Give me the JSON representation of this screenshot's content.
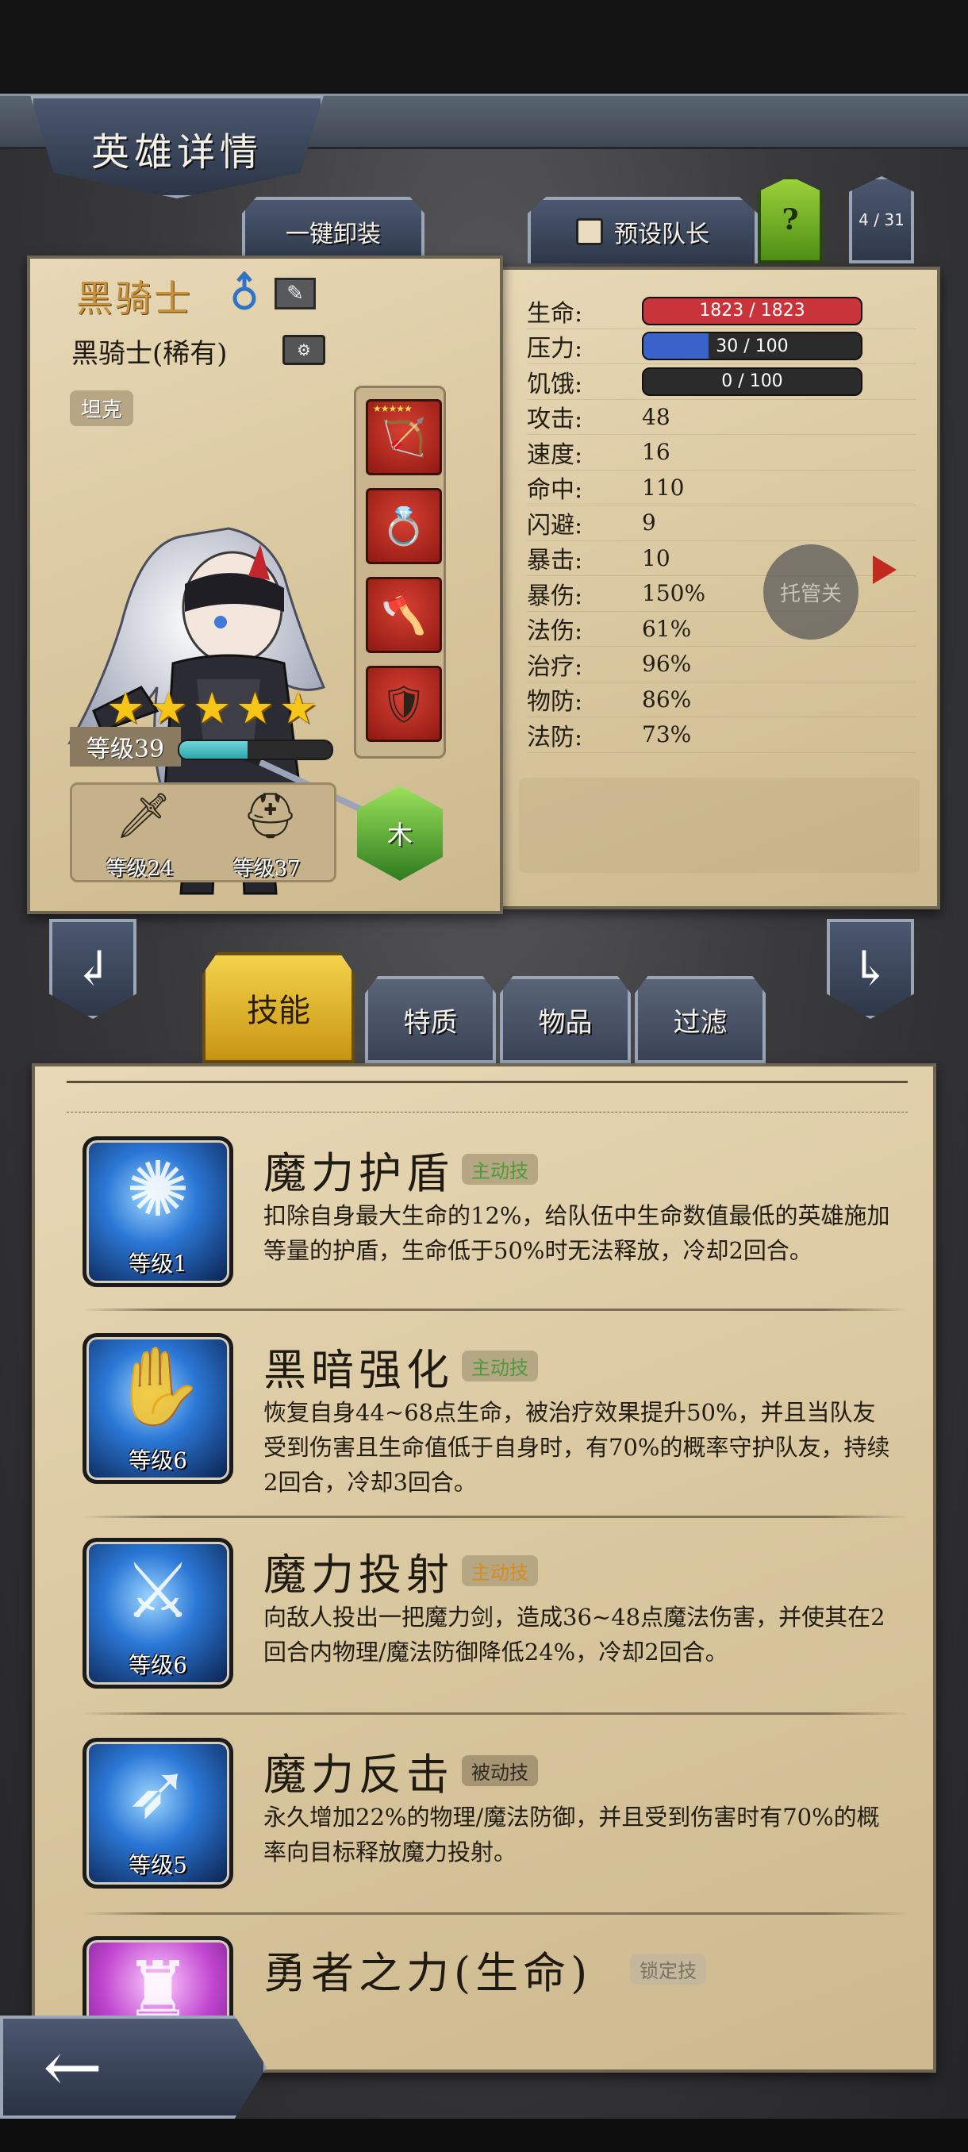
{
  "screen": {
    "title": "英雄详情"
  },
  "toolbar": {
    "unequip_label": "一键卸装",
    "captain_label": "预设队长",
    "help_label": "?",
    "page_indicator": "4 / 31"
  },
  "hero": {
    "name": "黑骑士",
    "gender_icon": "male-icon",
    "subname": "黑骑士(稀有)",
    "role": "坦克",
    "stars": 5,
    "level_label": "等级39",
    "xp_fraction": 0.45,
    "equipment_slots": [
      {
        "icon": "crossbow-icon",
        "stars": "★★★★★"
      },
      {
        "icon": "ring-icon",
        "stars": ""
      },
      {
        "icon": "axe-icon",
        "stars": ""
      },
      {
        "icon": "shield-icon",
        "stars": ""
      }
    ],
    "gear": [
      {
        "icon": "sword-icon",
        "level": "等级24"
      },
      {
        "icon": "helmet-icon",
        "level": "等级37"
      }
    ],
    "element": "木"
  },
  "stats": {
    "rows": [
      {
        "label": "生命:",
        "bar": true,
        "value": "1823 / 1823",
        "fill": 1.0,
        "color": "#c8343a"
      },
      {
        "label": "压力:",
        "bar": true,
        "value": "30 / 100",
        "fill": 0.3,
        "color": "#3a63c9"
      },
      {
        "label": "饥饿:",
        "bar": true,
        "value": "0 / 100",
        "fill": 0.0,
        "color": "#3a63c9"
      },
      {
        "label": "攻击:",
        "value": "48"
      },
      {
        "label": "速度:",
        "value": "16"
      },
      {
        "label": "命中:",
        "value": "110"
      },
      {
        "label": "闪避:",
        "value": "9"
      },
      {
        "label": "暴击:",
        "value": "10"
      },
      {
        "label": "暴伤:",
        "value": "150%"
      },
      {
        "label": "法伤:",
        "value": "61%"
      },
      {
        "label": "治疗:",
        "value": "96%"
      },
      {
        "label": "物防:",
        "value": "86%"
      },
      {
        "label": "法防:",
        "value": "73%"
      }
    ],
    "auto_label": "托管关"
  },
  "tabs": [
    {
      "label": "技能",
      "active": true
    },
    {
      "label": "特质",
      "active": false
    },
    {
      "label": "物品",
      "active": false
    },
    {
      "label": "过滤",
      "active": false
    }
  ],
  "skills": [
    {
      "name": "魔力护盾",
      "tag": "主动技",
      "level": "等级1",
      "desc": "扣除自身最大生命的12%，给队伍中生命数值最低的英雄施加等量的护盾，生命低于50%时无法释放，冷却2回合。"
    },
    {
      "name": "黑暗强化",
      "tag": "主动技",
      "level": "等级6",
      "desc": "恢复自身44~68点生命，被治疗效果提升50%，并且当队友受到伤害且生命值低于自身时，有70%的概率守护队友，持续2回合，冷却3回合。"
    },
    {
      "name": "魔力投射",
      "tag": "主动技",
      "level": "等级6",
      "desc": "向敌人投出一把魔力剑，造成36~48点魔法伤害，并使其在2回合内物理/魔法防御降低24%，冷却2回合。"
    },
    {
      "name": "魔力反击",
      "tag": "被动技",
      "level": "等级5",
      "desc": "永久增加22%的物理/魔法防御，并且受到伤害时有70%的概率向目标释放魔力投射。"
    },
    {
      "name": "勇者之力(生命)",
      "tag": "锁定技",
      "level": "",
      "desc": ""
    }
  ],
  "back_button": "←"
}
